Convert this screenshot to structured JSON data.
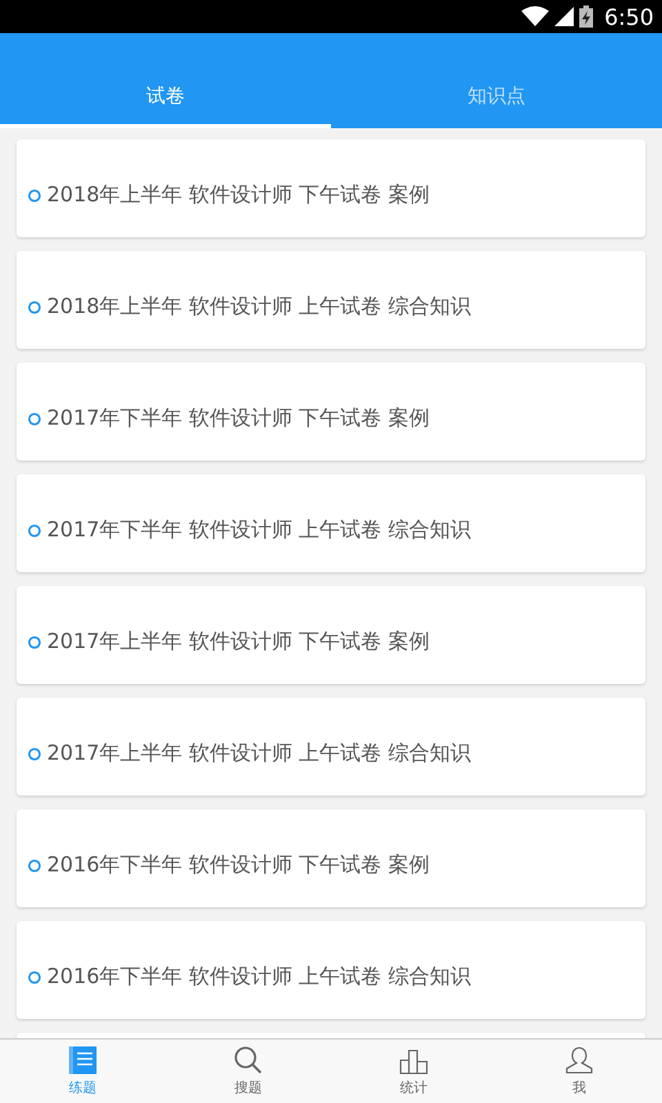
{
  "status_bar": {
    "time": "6:50"
  },
  "tabs": [
    {
      "label": "试卷",
      "selected": true
    },
    {
      "label": "知识点",
      "selected": false
    }
  ],
  "papers": [
    {
      "title": "2018年上半年 软件设计师 下午试卷 案例"
    },
    {
      "title": "2018年上半年 软件设计师 上午试卷 综合知识"
    },
    {
      "title": "2017年下半年 软件设计师 下午试卷 案例"
    },
    {
      "title": "2017年下半年 软件设计师 上午试卷 综合知识"
    },
    {
      "title": "2017年上半年 软件设计师 下午试卷 案例"
    },
    {
      "title": "2017年上半年 软件设计师 上午试卷 综合知识"
    },
    {
      "title": "2016年下半年 软件设计师 下午试卷 案例"
    },
    {
      "title": "2016年下半年 软件设计师 上午试卷 综合知识"
    }
  ],
  "bottom_nav": [
    {
      "label": "练题",
      "kind": "book",
      "selected": true
    },
    {
      "label": "搜题",
      "kind": "search",
      "selected": false
    },
    {
      "label": "统计",
      "kind": "chart",
      "selected": false
    },
    {
      "label": "我",
      "kind": "person",
      "selected": false
    }
  ]
}
